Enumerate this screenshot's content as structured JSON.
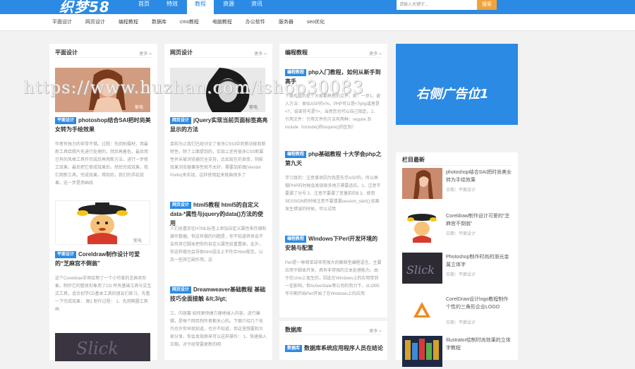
{
  "header": {
    "logo": "织梦58",
    "nav": [
      "首页",
      "特效",
      "教程",
      "资源",
      "资讯"
    ],
    "active_nav": "教程",
    "search_placeholder": "请输入关键字...",
    "search_button": "搜索"
  },
  "subnav": [
    "平面设计",
    "网页设计",
    "编程教程",
    "数据库",
    "cms教程",
    "电脑教程",
    "办公软件",
    "服务器",
    "seo优化"
  ],
  "more": "更多",
  "columns": [
    {
      "title": "平面设计",
      "items": [
        {
          "tag": "平面设计",
          "title": "photoshop结合SAI把时尚美女转为手绘效果",
          "desc": "作者有独力的非常不错。过程：先回拍摄材，用最新工具给照片先进行处理的，然后再着色，最后用已有的风格工具作完成后再用新方法，进行一步修工效果，最后把它修成效果后，然后完成效果，我们用新工具。完成效果，得到后，我们的手绘效果。这一步是用画线"
        },
        {
          "tag": "平面设计",
          "title": "Coreldraw制作设计可爱的“芝麻宫不倒翁”",
          "desc": "这个Coreldraw实例绘制了一个小可爱的芝麻官形象。制作它的整体形象用了CD 所有基础工具与交互式工具，适合初学CD基本工具的朋友们练习。先看一下完成效果：   图1   制作过程：   1、先用椭圆工具画"
        }
      ]
    },
    {
      "title": "网页设计",
      "items": [
        {
          "tag": "网页设计",
          "title": "jQuery实现当前页面标签高亮显示的方法",
          "desc": "目前为止我们已经讨论了很多CSS3中的新功能和新特性，除了上面提到的，实现上还有很多CSS新属性并未被浏览器完全支持，比如现在的渐变，阴影效果浏览器兼容性就不太好，需要加前缀(Vendor Prefix)来实现，这样使用起来就麻烦多了"
        },
        {
          "tag": "网页设计",
          "title": "html5教程 html5的自定义data-*属性与jquery的data()方法的使用",
          "desc": "人们总喜欢往HTML标签上添加自定义属性来存储和操作数据。但这样做的问题是，你不知道将来会不会有其它脚本把你的自定义属性给重置掉，此外，你这样做也会导致html语法上不符合Html规范，以及一些其它副作用。这"
        },
        {
          "tag": "网页设计",
          "title": "Dreamweaver基础教程 基础技巧全面接触 &lt;3/gt;",
          "desc": "三、内容篇 如何更快捷方便地插入内容，进行编辑，是每个网页制作者都关心的。下面介绍几个技巧也许你早就知道，也许不知道，但这里想要和大家分享，你会发现原来可以这样操作：   1、快速插入日期。对于经常要更新的网"
        }
      ]
    },
    {
      "title": "编程教程",
      "items": [
        {
          "tag": "编程教程",
          "title": "php入门教程，如何从新手到高手",
          "desc": "下面先说的是个大家都熟悉的文件，即：一步1、嵌入方法：类似ASP的<%，PHP可以是<?php或者是<?，结束符号是?>，当然您也可以自己指定。2、引用文件：引用文件的方法有两种：require 及 include（include()和require()的区别）"
        },
        {
          "tag": "编程教程",
          "title": "php基础教程 十大学会php之第九天",
          "desc": "学习目的：注意事项因为我是先学ASP的，所以再做PHP的时候会发现很多地方需要适应。1、注意不要漏了分号 2、注意不要漏了变量前的$ 3、使用SESSION的时候注意不要遗漏session_start();如果发生错误的时候，可以试用"
        },
        {
          "tag": "编程教程",
          "title": "Windows下Perl开发环境的安装与配置",
          "desc": "Perl是一种简单却非常强大的解释型编程语言，主要应用于脚本开发，具有非常强的文本处理能力，由于在Unix上诞生的，因此在Windows上的应用受到一定影响，但ActiveState等公司的努力下，从1995年中期开始Perl开始了在Windows上的应用"
        }
      ]
    },
    {
      "title": "数据库",
      "items": [
        {
          "tag": "数据库",
          "title": "数据库系统应用程序人员在结论"
        }
      ]
    }
  ],
  "ad_text": "右侧广告位1",
  "sidebar": {
    "title": "栏目最新",
    "items": [
      {
        "title": "photoshop结合SAI把时尚美女转为手绘效果",
        "date": "日期：平面设计"
      },
      {
        "title": "Coreldraw制作设计可爱的“芝麻宫不倒翁”",
        "date": "日期：平面设计"
      },
      {
        "title": "Photoshop制作时尚的渐光金属立体字",
        "date": "日期：平面设计"
      },
      {
        "title": "CorelDraw设计logo教程制作个性的三角形企业LOGO",
        "date": "日期：平面设计"
      },
      {
        "title": "Illustrator绘制时尚效果的立体字教程",
        "date": ""
      }
    ]
  },
  "watermark": "https://www.huzhan.com/ishop30083",
  "colors": {
    "primary": "#2b8ae4",
    "search_button": "#f2a23c"
  }
}
